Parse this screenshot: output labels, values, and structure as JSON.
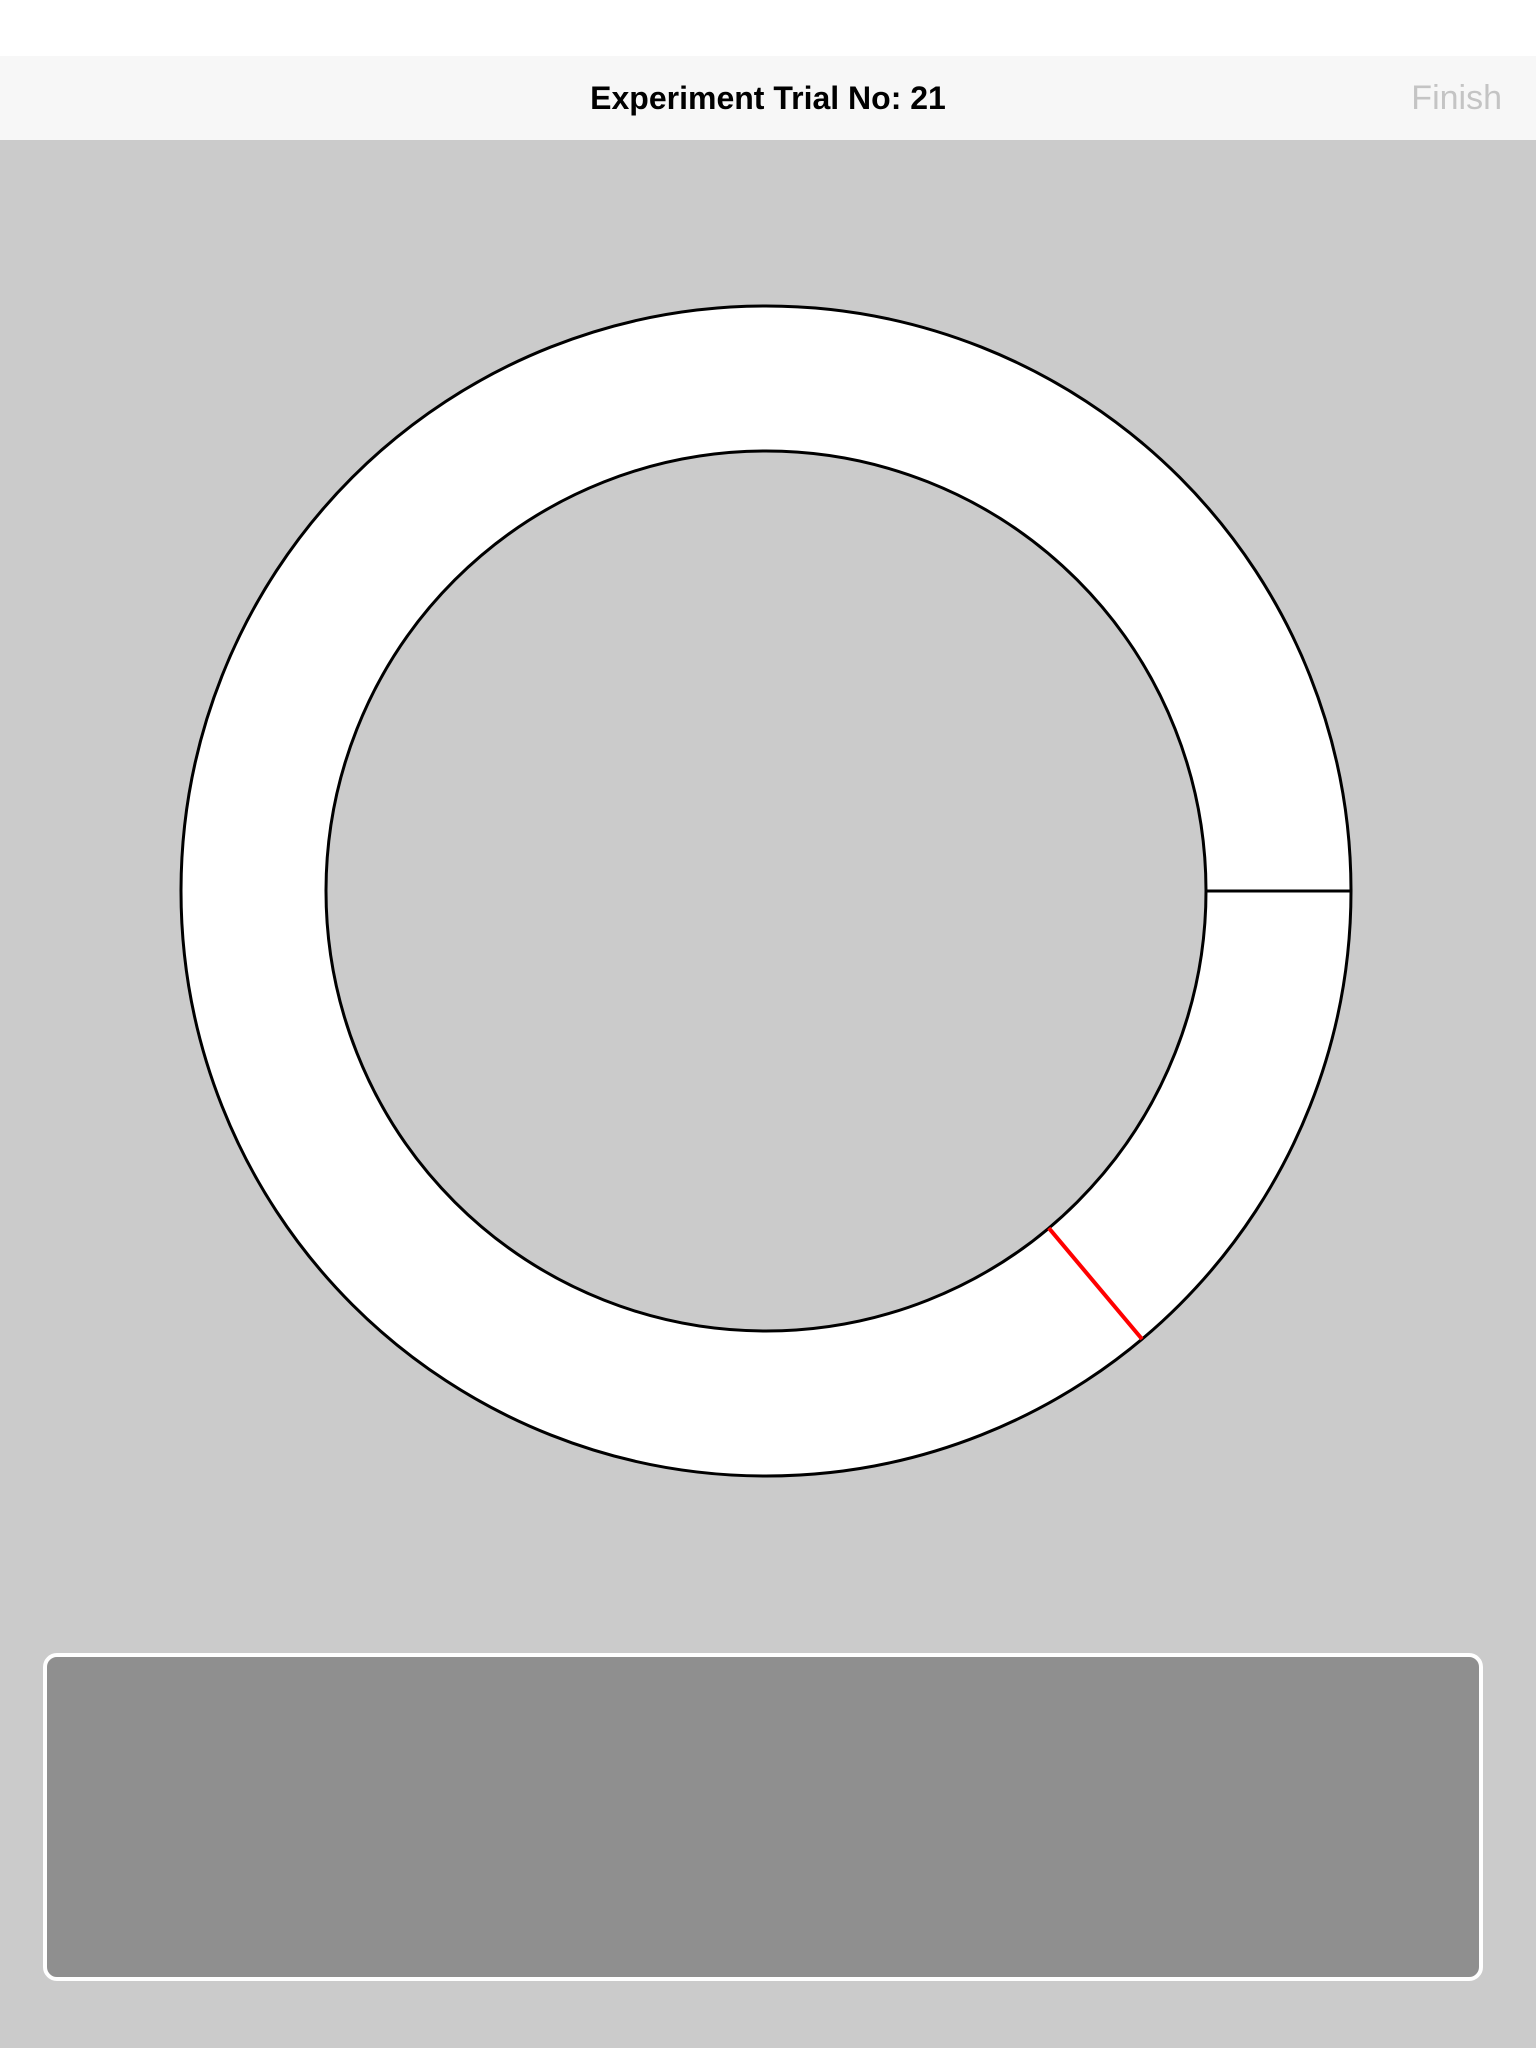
{
  "header": {
    "title": "Experiment Trial No: 21",
    "finish_label": "Finish"
  },
  "dial": {
    "ring_color": "#ffffff",
    "outline_color": "#000000",
    "reference_marker_color": "#000000",
    "response_marker_color": "#ff0000",
    "reference_angle_deg": 0,
    "response_angle_deg": -50
  },
  "colors": {
    "background": "#cbcbcb",
    "nav_background": "#f7f7f7",
    "finish_disabled": "#c4c4c4",
    "panel": "#8f8f8f"
  },
  "response_panel": {}
}
